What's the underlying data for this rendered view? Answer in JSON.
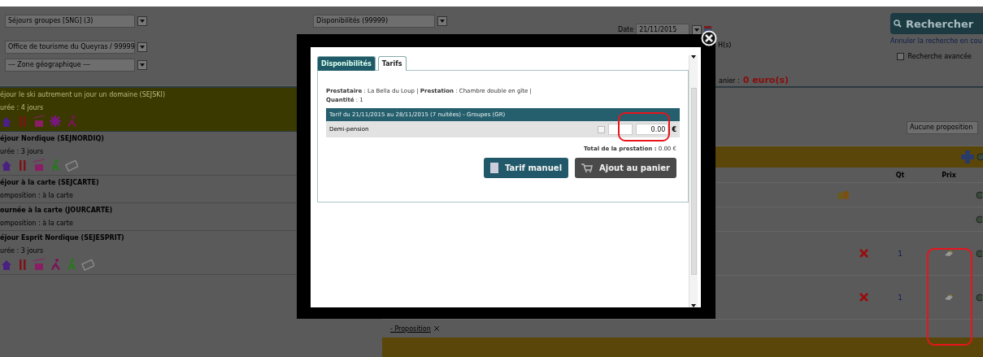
{
  "filters": {
    "left_selects": [
      "Séjours groupes [SNG] (3)",
      "Office de tourisme du Queyras / 99999",
      "--- Zone géographique ---"
    ],
    "availability_select": "Disponibilités (99999)",
    "date": {
      "label": "Date",
      "value": "21/11/2015"
    },
    "search_button": "Rechercher",
    "cancel_link": "Annuler la recherche en cou",
    "partial_label": "H(s)",
    "advanced_search": {
      "label": "Recherche avancée",
      "checked": false
    }
  },
  "cart_total": {
    "label": "anier :",
    "value": "0 euro(s)"
  },
  "packages": [
    {
      "title": "éjour le ski autrement un jour un domaine (SEJSKI)",
      "detail": "urée : 4 jours",
      "selected": true,
      "icons": [
        {
          "kind": "house"
        },
        {
          "kind": "cutlery"
        },
        {
          "kind": "gondola"
        },
        {
          "kind": "snowflake"
        },
        {
          "kind": "skier"
        }
      ]
    },
    {
      "title": "éjour Nordique (SEJNORDIQ)",
      "detail": "urée : 3 jours",
      "selected": false,
      "icons": [
        {
          "kind": "house"
        },
        {
          "kind": "cutlery"
        },
        {
          "kind": "gondola"
        },
        {
          "kind": "hiker"
        },
        {
          "kind": "ticket"
        }
      ]
    },
    {
      "title": "éjour à la carte (SEJCARTE)",
      "detail": "omposition : à la carte",
      "selected": false
    },
    {
      "title": "ournée à la carte (JOURCARTE)",
      "detail": "omposition : à la carte",
      "selected": false
    },
    {
      "title": "éjour Esprit Nordique (SEJESPRIT)",
      "detail": "urée : 3 jours",
      "selected": false,
      "icons": [
        {
          "kind": "house"
        },
        {
          "kind": "cutlery"
        },
        {
          "kind": "gondola"
        },
        {
          "kind": "skier"
        },
        {
          "kind": "hiker"
        },
        {
          "kind": "ticket"
        }
      ]
    }
  ],
  "proposal_select": "Aucune proposition",
  "table": {
    "columns": [
      "Qt",
      "Prix"
    ],
    "rows": [
      {
        "kind": "info"
      },
      {
        "kind": "empty"
      },
      {
        "kind": "item",
        "qty": "1"
      },
      {
        "kind": "item",
        "qty": "1"
      }
    ]
  },
  "proposal_link": "- Proposition",
  "modal": {
    "tabs": [
      {
        "label": "Disponibilités",
        "selected": false
      },
      {
        "label": "Tarifs",
        "selected": true
      }
    ],
    "summary": "**Prestataire** : La Bella du Loup | **Prestation** : Chambre double en gîte | **Quantité** : 1",
    "rate_header": "Tarif du 21/11/2015 au 28/11/2015 (7 nuitées) - Groupes (GR)",
    "rates": [
      {
        "label": "Demi-pension",
        "checked": false,
        "price": "0.00",
        "currency": "€"
      }
    ],
    "total": {
      "label": "Total de la prestation :",
      "value": "0.00 €"
    },
    "buttons": [
      {
        "kind": "primary",
        "label": "Tarif manuel"
      },
      {
        "kind": "secondary",
        "label": "Ajout au panier"
      }
    ]
  }
}
